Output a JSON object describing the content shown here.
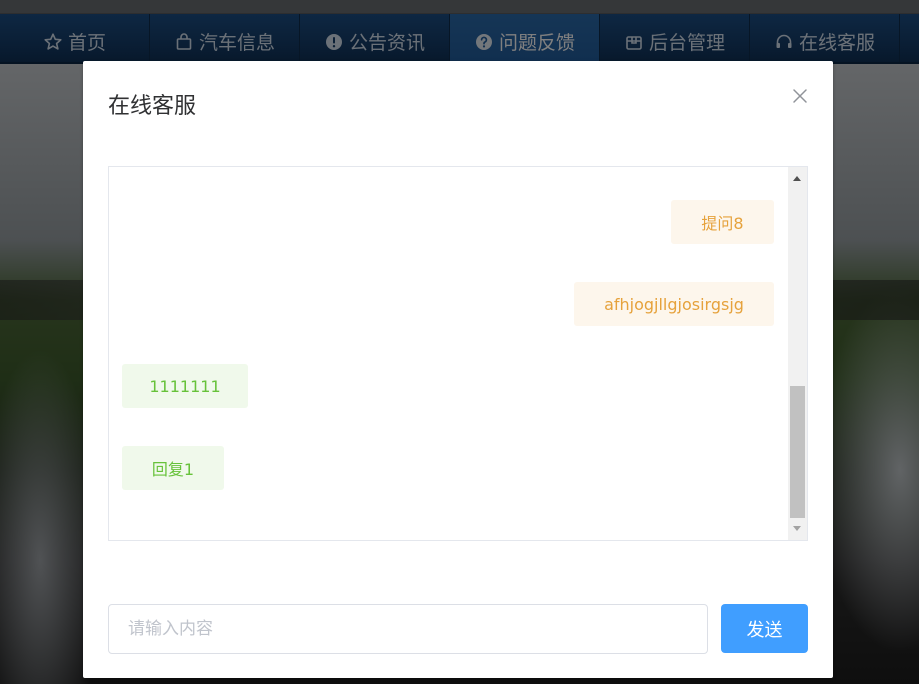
{
  "nav": {
    "items": [
      {
        "label": "首页",
        "icon": "star-icon"
      },
      {
        "label": "汽车信息",
        "icon": "shopping-bag-icon"
      },
      {
        "label": "公告资讯",
        "icon": "warning-circle-icon"
      },
      {
        "label": "问题反馈",
        "icon": "question-circle-icon",
        "active": true
      },
      {
        "label": "后台管理",
        "icon": "package-icon"
      },
      {
        "label": "在线客服",
        "icon": "headset-icon"
      }
    ]
  },
  "dialog": {
    "title": "在线客服",
    "close_icon": "close-icon"
  },
  "chat": {
    "messages": [
      {
        "from": "user",
        "text": "提问8"
      },
      {
        "from": "user",
        "text": "afhjogjllgjosirgsjg"
      },
      {
        "from": "service",
        "text": "1111111"
      },
      {
        "from": "service",
        "text": "回复1"
      }
    ]
  },
  "composer": {
    "placeholder": "请输入内容",
    "value": "",
    "send_label": "发送"
  },
  "colors": {
    "nav_bg": "#163f6d",
    "nav_active": "#225e9e",
    "sent_bg": "#fdf6ec",
    "sent_text": "#e6a23c",
    "recv_bg": "#f0f9eb",
    "recv_text": "#67c23a",
    "primary": "#409eff"
  }
}
